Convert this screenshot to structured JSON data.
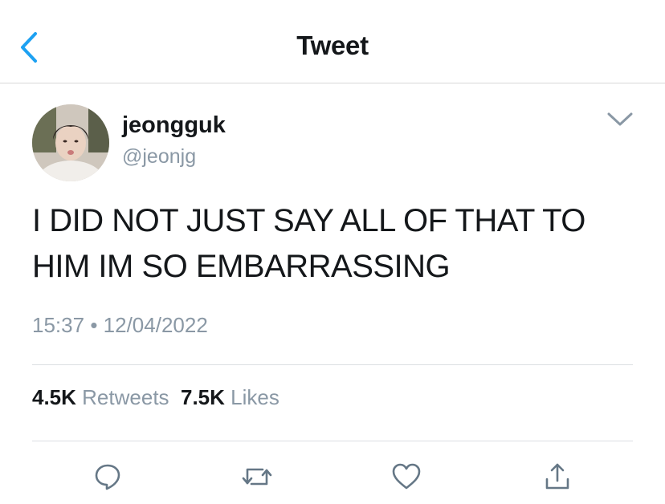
{
  "header": {
    "title": "Tweet"
  },
  "tweet": {
    "author": {
      "display_name": "jeongguk",
      "handle": "@jeonjg"
    },
    "text": "I DID NOT JUST SAY ALL OF THAT TO HIM IM SO EMBARRASSING",
    "time": "15:37",
    "separator": "•",
    "date": "12/04/2022"
  },
  "stats": {
    "retweets_count": "4.5K",
    "retweets_label": "Retweets",
    "likes_count": "7.5K",
    "likes_label": "Likes"
  },
  "icons": {
    "back": "chevron-left-icon",
    "more": "chevron-down-icon",
    "reply": "reply-icon",
    "retweet": "retweet-icon",
    "like": "heart-icon",
    "share": "share-icon"
  },
  "colors": {
    "accent": "#1da1f2",
    "secondary_text": "#8a98a5",
    "icon": "#657786"
  }
}
